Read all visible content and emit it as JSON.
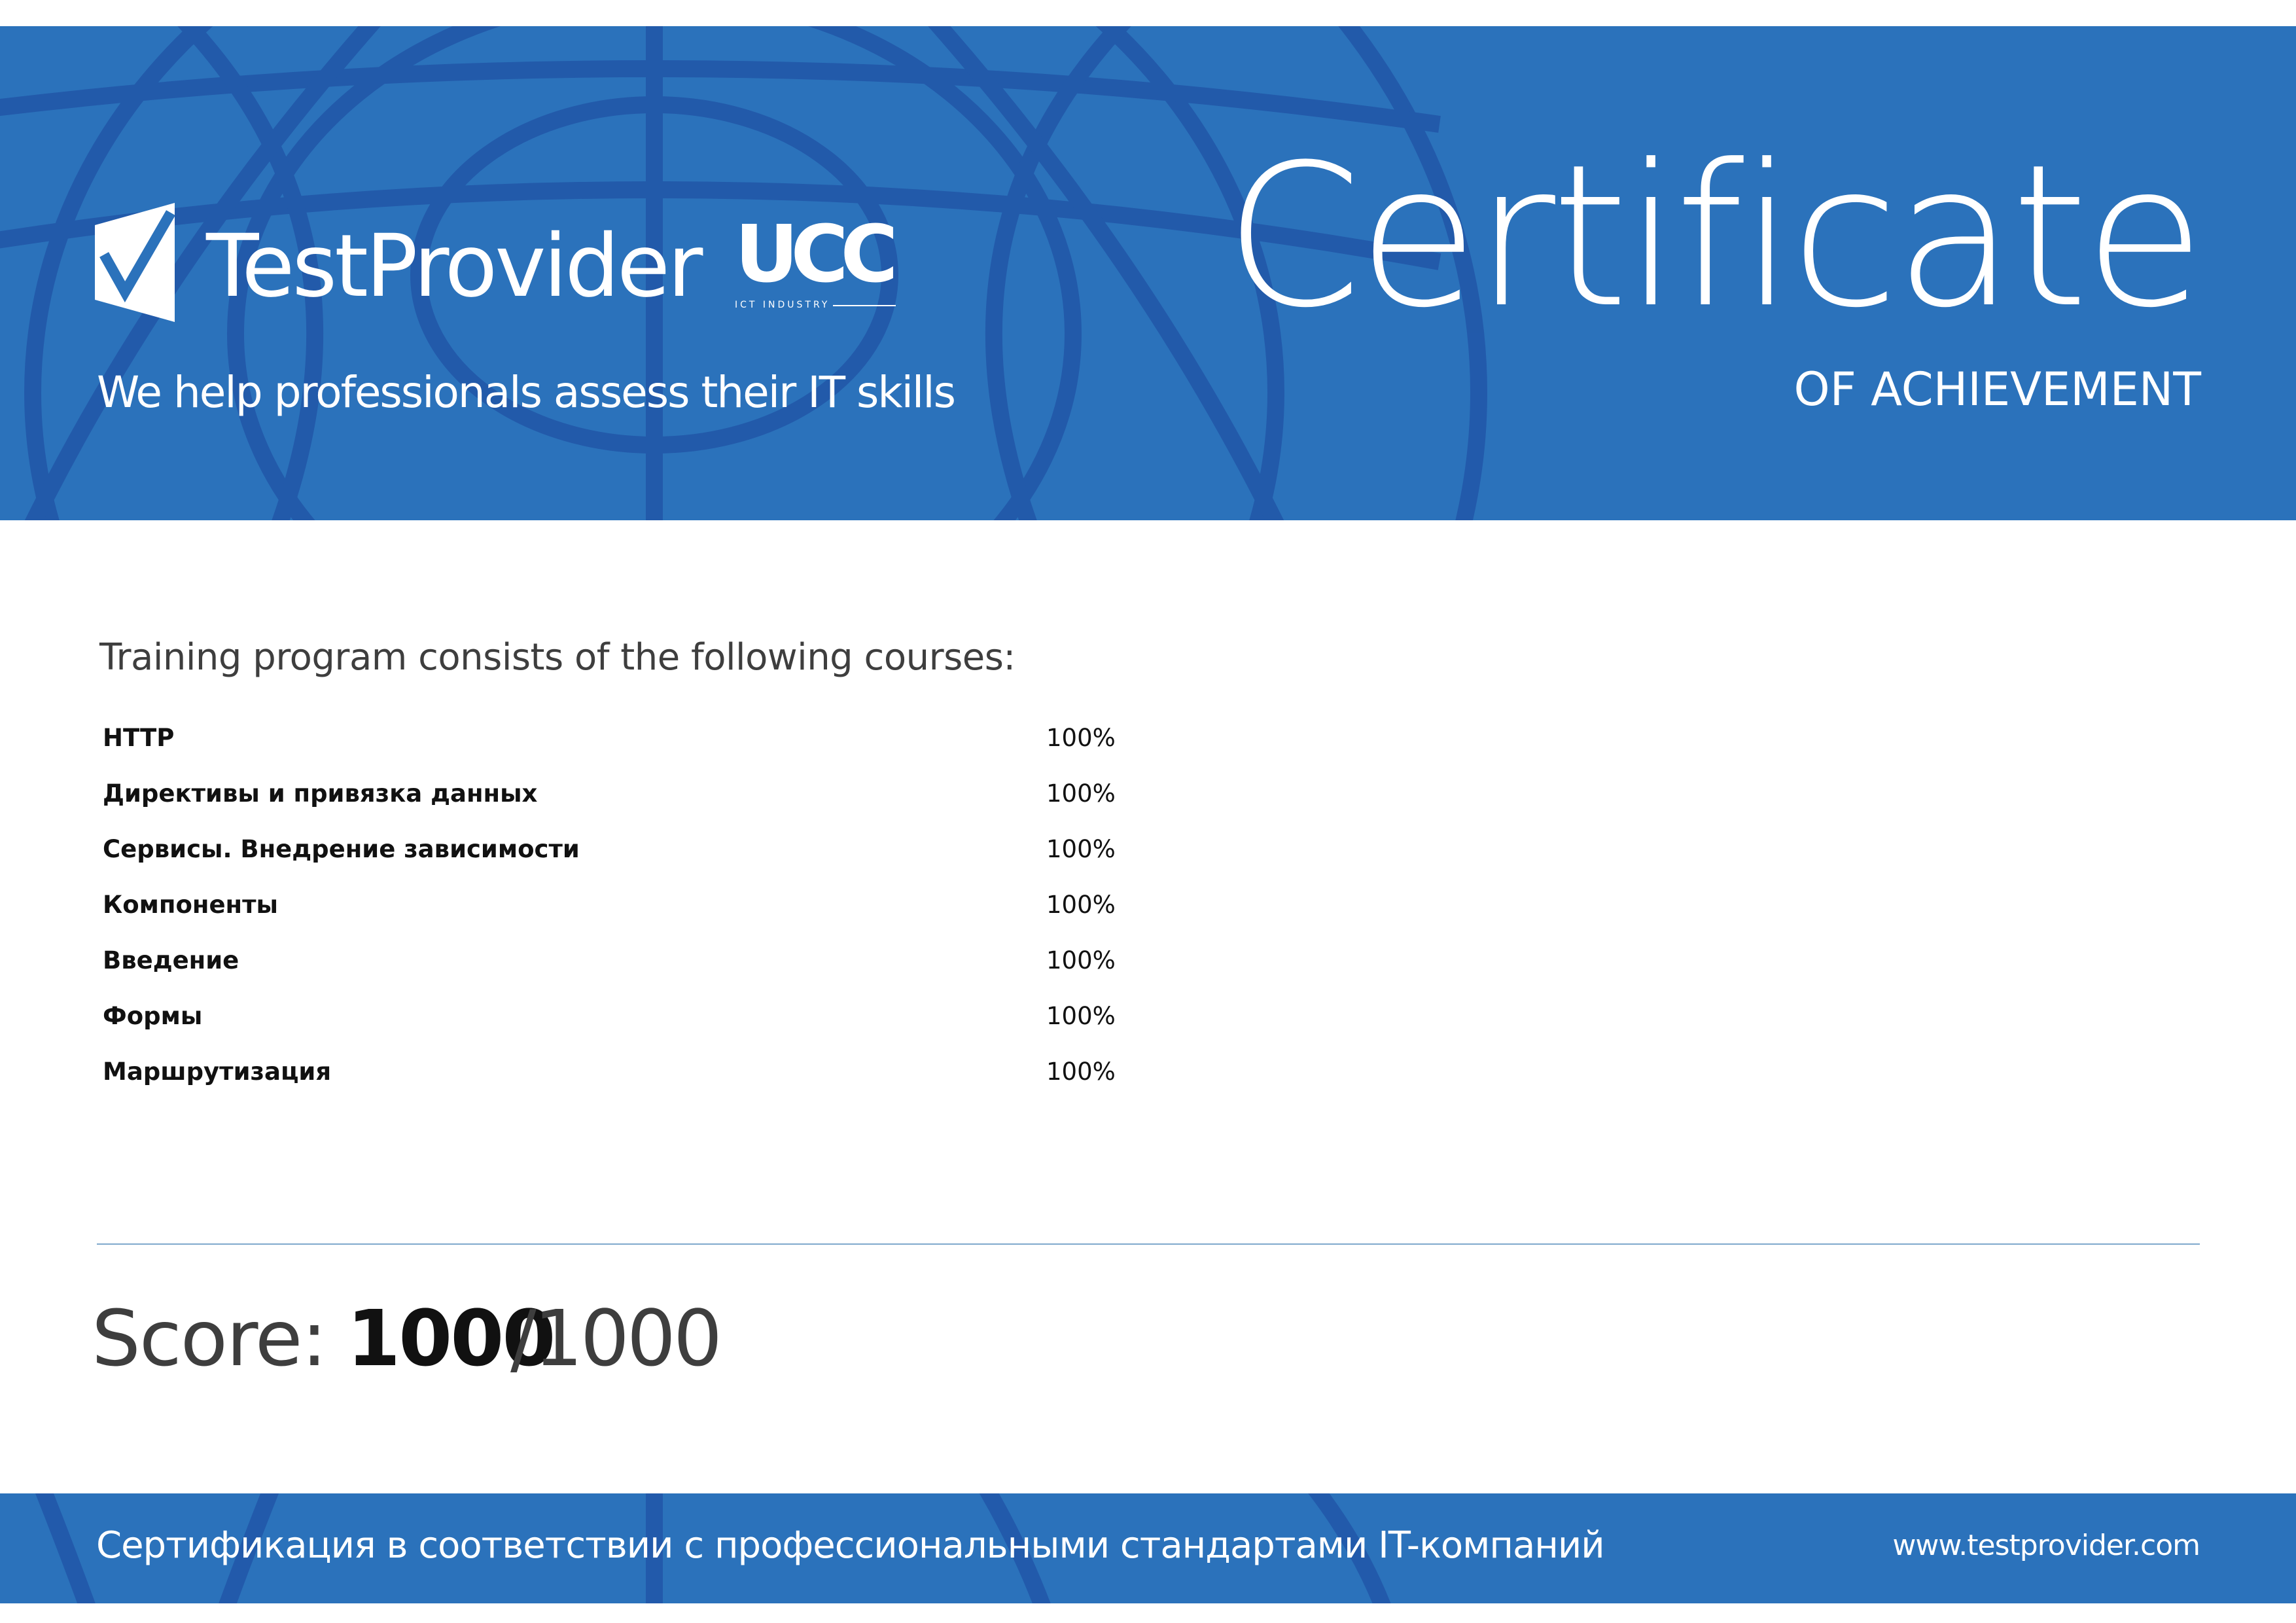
{
  "brand": {
    "name": "TestProvider",
    "tagline": "We help professionals assess their IT skills",
    "partner_logo": "UCC",
    "partner_sub": "ICT INDUSTRY"
  },
  "certificate": {
    "title": "Certificate",
    "subtitle": "OF ACHIEVEMENT"
  },
  "program": {
    "intro": "Training program consists of the following courses:",
    "courses": [
      {
        "name": "HTTP",
        "score": "100%"
      },
      {
        "name": "Директивы и привязка данных",
        "score": "100%"
      },
      {
        "name": "Сервисы. Внедрение зависимости",
        "score": "100%"
      },
      {
        "name": "Компоненты",
        "score": "100%"
      },
      {
        "name": "Введение",
        "score": "100%"
      },
      {
        "name": "Формы",
        "score": "100%"
      },
      {
        "name": "Маршрутизация",
        "score": "100%"
      }
    ]
  },
  "score": {
    "label": "Score:",
    "value": "1000",
    "total": "/1000"
  },
  "footer": {
    "text": "Сертификация в соответствии с профессиональными стандартами IT-компаний",
    "url": "www.testprovider.com"
  },
  "colors": {
    "band": "#2b72bb",
    "globe_lines": "#2156a8",
    "divider": "#7fa9cc"
  },
  "icons": {
    "brand_mark": "checkmark-shield-icon",
    "background": "globe-icon"
  }
}
